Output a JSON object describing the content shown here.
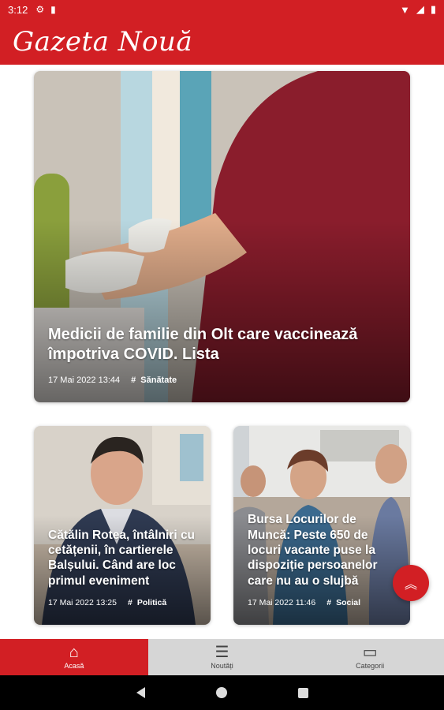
{
  "status_bar": {
    "time": "3:12"
  },
  "app": {
    "logo_text": "Gazeta Nouă",
    "brand_color": "#d21f24"
  },
  "articles": [
    {
      "title": "Medicii de familie din Olt care vaccinează împotriva COVID. Lista",
      "date": "17 Mai 2022 13:44",
      "category": "Sănătate"
    },
    {
      "title": "Cătălin Rotea, întâlniri cu cetățenii, în cartierele Balșului. Când are loc primul eveniment",
      "date": "17 Mai 2022 13:25",
      "category": "Politică"
    },
    {
      "title": "Bursa Locurilor de Muncă: Peste 650 de locuri vacante puse la dispoziție persoanelor care nu au o slujbă",
      "date": "17 Mai 2022 11:46",
      "category": "Social"
    }
  ],
  "nav": [
    {
      "label": "Acasă",
      "icon": "home-icon"
    },
    {
      "label": "Noutăți",
      "icon": "list-icon"
    },
    {
      "label": "Categorii",
      "icon": "folder-icon"
    }
  ]
}
